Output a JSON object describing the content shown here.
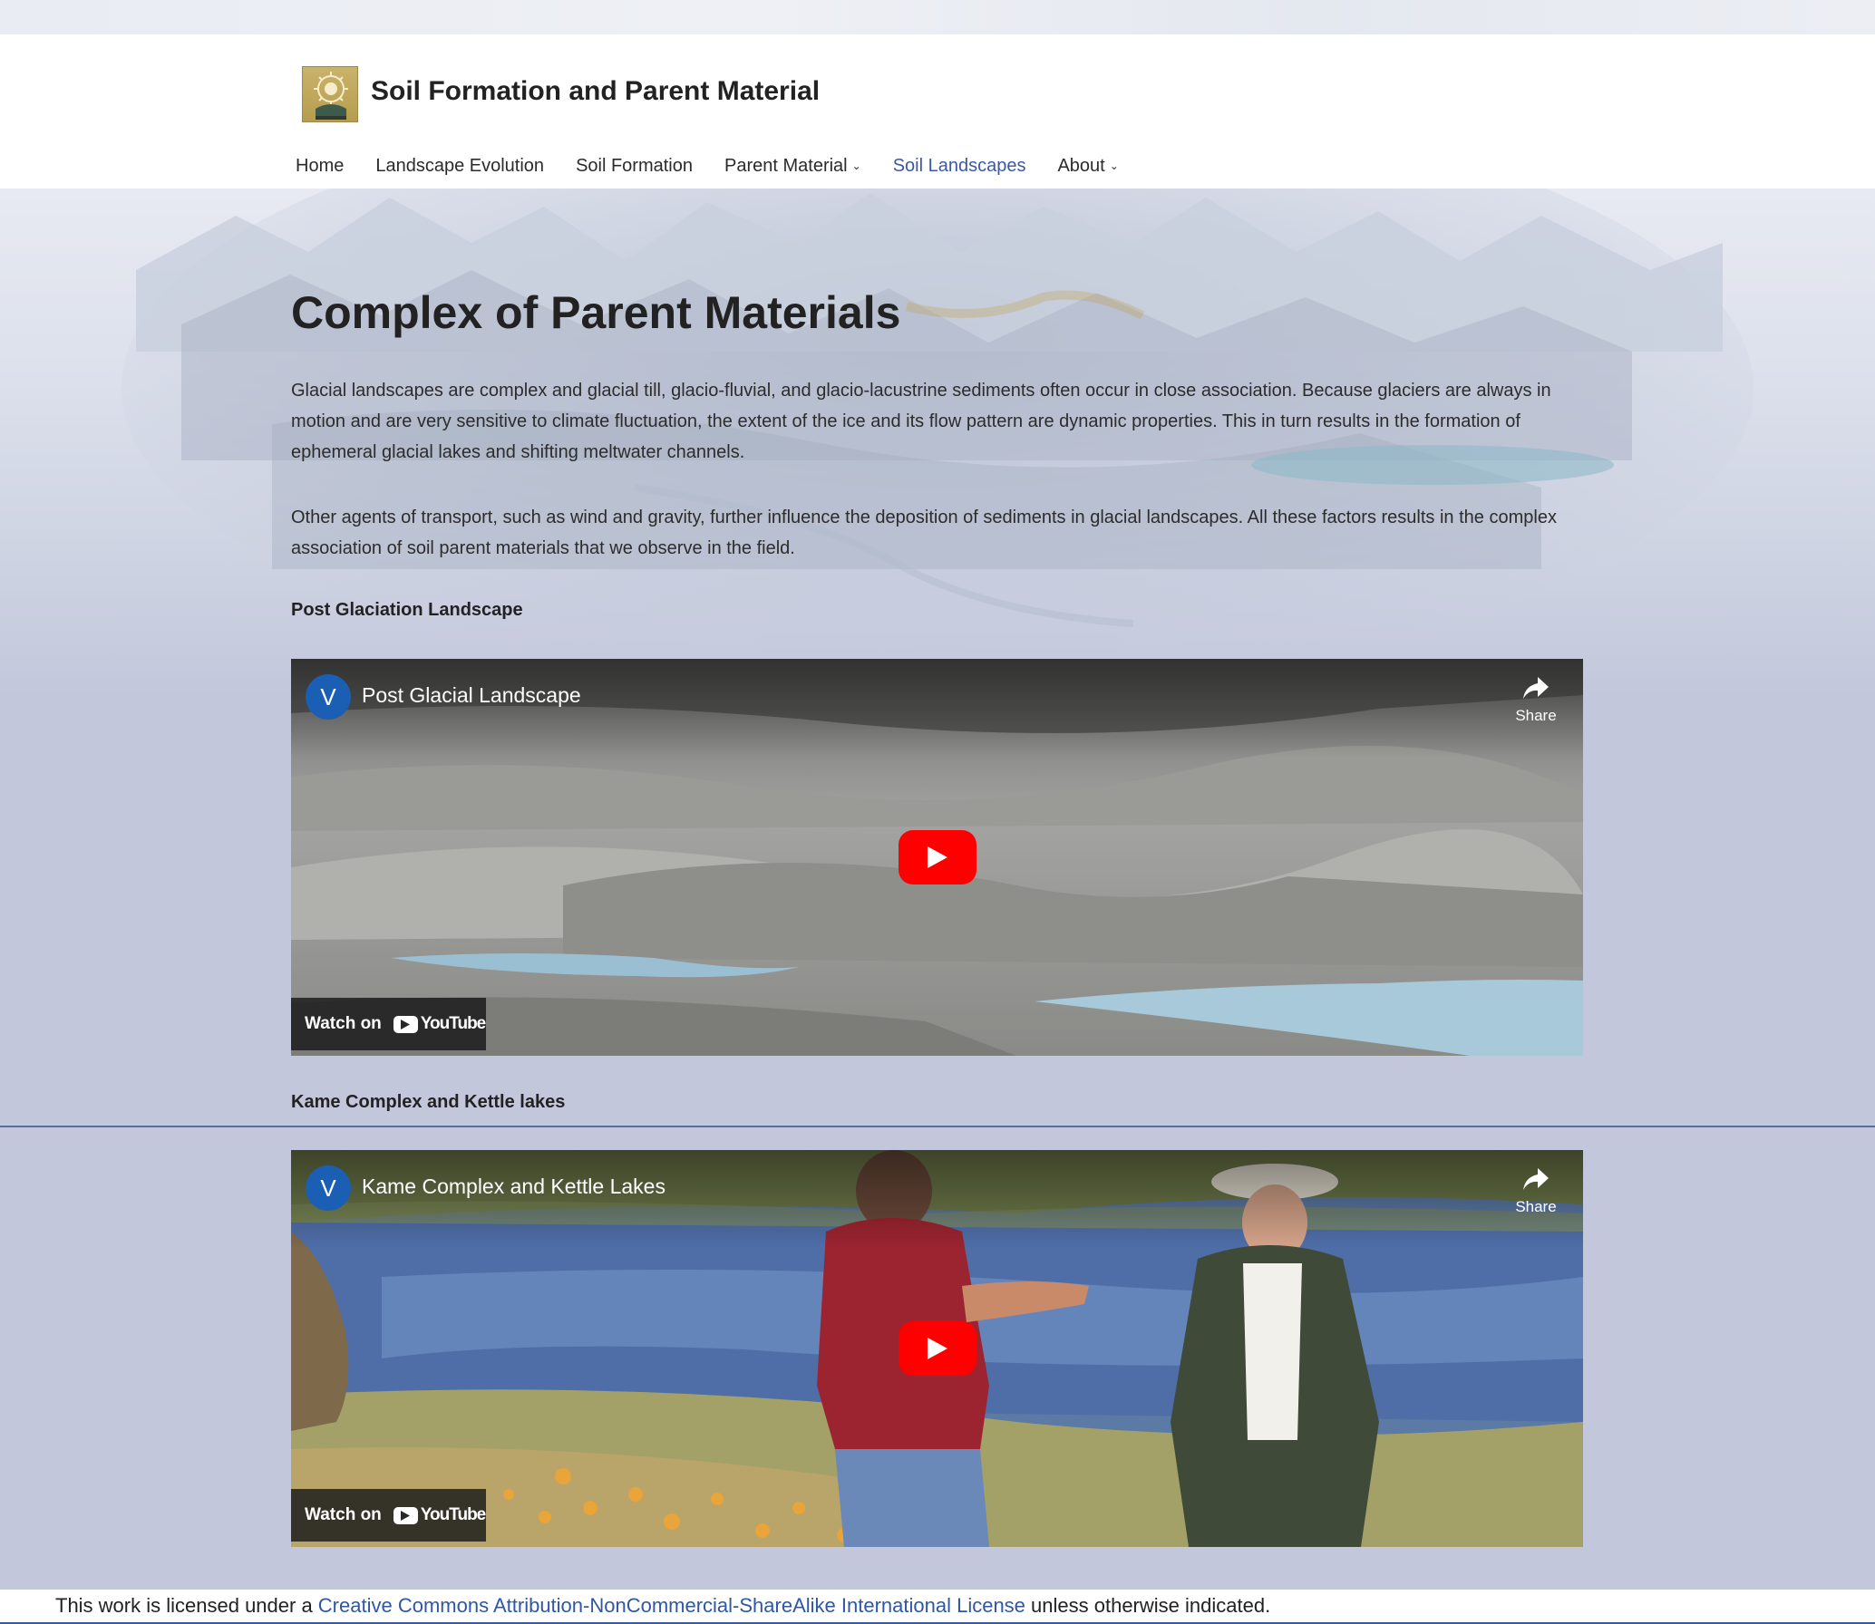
{
  "site": {
    "title": "Soil Formation and Parent Material"
  },
  "nav": {
    "items": [
      {
        "label": "Home",
        "active": false,
        "dropdown": false
      },
      {
        "label": "Landscape Evolution",
        "active": false,
        "dropdown": false
      },
      {
        "label": "Soil Formation",
        "active": false,
        "dropdown": false
      },
      {
        "label": "Parent Material",
        "active": false,
        "dropdown": true
      },
      {
        "label": "Soil Landscapes",
        "active": true,
        "dropdown": false
      },
      {
        "label": "About",
        "active": false,
        "dropdown": true
      }
    ]
  },
  "main": {
    "title": "Complex of Parent Materials",
    "paragraphs": [
      "Glacial landscapes are complex and glacial till, glacio-fluvial, and glacio-lacustrine sediments often occur in close association. Because glaciers are always in motion and are very sensitive to climate fluctuation, the extent of the ice and its flow pattern are dynamic properties. This in turn results in the formation of ephemeral glacial lakes and shifting meltwater channels.",
      "Other agents of transport, such as wind and gravity, further influence the deposition of sediments in glacial landscapes. All these factors results in the complex association of soil parent materials that we observe in the field."
    ],
    "sections": [
      {
        "heading": "Post Glaciation Landscape",
        "video": {
          "title": "Post Glacial Landscape",
          "channel_initial": "V",
          "share_label": "Share",
          "watch_on_label": "Watch on",
          "youtube_label": "YouTube"
        }
      },
      {
        "heading": "Kame Complex and Kettle lakes",
        "video": {
          "title": "Kame Complex and Kettle Lakes",
          "channel_initial": "V",
          "share_label": "Share",
          "watch_on_label": "Watch on",
          "youtube_label": "YouTube"
        }
      }
    ]
  },
  "footer": {
    "prefix": "This work is licensed under a ",
    "link_text": "Creative Commons Attribution-NonCommercial-ShareAlike International License",
    "suffix": " unless otherwise indicated."
  },
  "colors": {
    "accent": "#3a58a8",
    "background": "#c3c7db",
    "youtube_red": "#ff0000",
    "link": "#2e58a6"
  },
  "icons": {
    "logo": "sunflower-logo-icon",
    "share": "share-arrow-icon",
    "play": "youtube-play-icon",
    "dropdown": "chevron-down-icon"
  }
}
